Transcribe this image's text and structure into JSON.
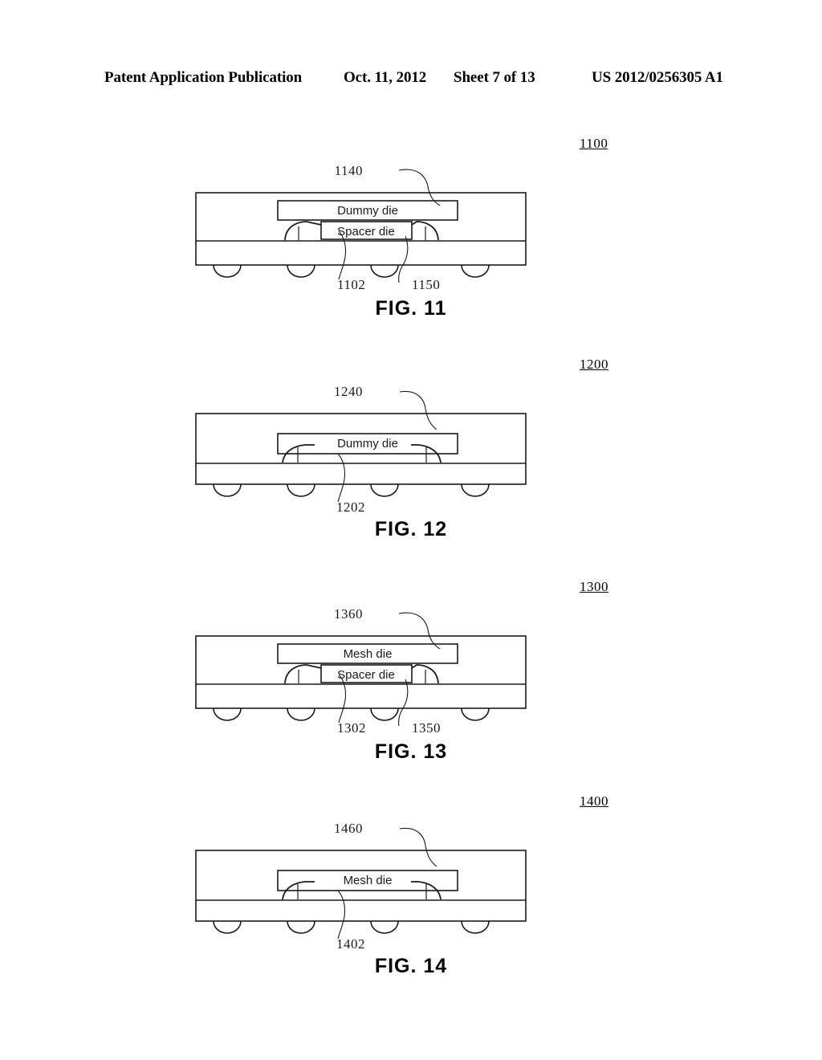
{
  "header": {
    "publication": "Patent Application Publication",
    "date": "Oct. 11, 2012",
    "sheet": "Sheet 7 of 13",
    "pub_number": "US 2012/0256305 A1"
  },
  "colors": {
    "ink": "#000000",
    "line": "#1a1a1a",
    "background": "#ffffff"
  },
  "figures": [
    {
      "id": "fig11",
      "caption": "FIG. 11",
      "ref_number": "1100",
      "top_die_label": "Dummy die",
      "spacer_die_label": "Spacer die",
      "has_spacer": true,
      "callouts": {
        "top_die": "1140",
        "wire_bond": "1102",
        "spacer": "1150"
      }
    },
    {
      "id": "fig12",
      "caption": "FIG. 12",
      "ref_number": "1200",
      "top_die_label": "Dummy die",
      "spacer_die_label": "",
      "has_spacer": false,
      "callouts": {
        "top_die": "1240",
        "wire_bond": "1202",
        "spacer": ""
      }
    },
    {
      "id": "fig13",
      "caption": "FIG. 13",
      "ref_number": "1300",
      "top_die_label": "Mesh die",
      "spacer_die_label": "Spacer die",
      "has_spacer": true,
      "callouts": {
        "top_die": "1360",
        "wire_bond": "1302",
        "spacer": "1350"
      }
    },
    {
      "id": "fig14",
      "caption": "FIG. 14",
      "ref_number": "1400",
      "top_die_label": "Mesh die",
      "spacer_die_label": "",
      "has_spacer": false,
      "callouts": {
        "top_die": "1460",
        "wire_bond": "1402",
        "spacer": ""
      }
    }
  ]
}
